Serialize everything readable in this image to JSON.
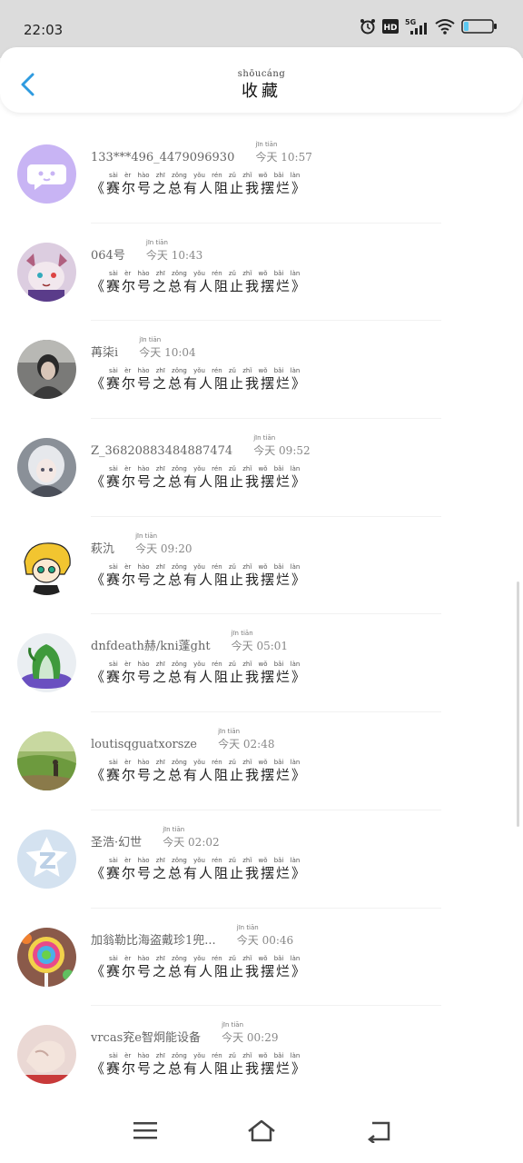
{
  "status_bar": {
    "time": "22:03",
    "icons": [
      "alarm-icon",
      "hd-icon",
      "5g-signal-icon",
      "wifi-icon",
      "battery-icon"
    ],
    "hd_label": "HD",
    "network_label": "5G"
  },
  "header": {
    "title_pinyin": "shōucáng",
    "title": "收藏"
  },
  "items": [
    {
      "name": "133***496_4479096930",
      "time": "今天 10:57",
      "time_pinyin": "jīn tiān",
      "message": "《赛尔号之总有人阻止我摆烂》",
      "avatar": "chat-bubble-avatar"
    },
    {
      "name": "064号",
      "time": "今天 10:43",
      "time_pinyin": "jīn tiān",
      "message": "《赛尔号之总有人阻止我摆烂》",
      "avatar": "wolf-character-avatar"
    },
    {
      "name": "苒柒i",
      "time": "今天 10:04",
      "time_pinyin": "jīn tiān",
      "message": "《赛尔号之总有人阻止我摆烂》",
      "avatar": "photo-person-avatar"
    },
    {
      "name": "Z_36820883484887474",
      "time": "今天 09:52",
      "time_pinyin": "jīn tiān",
      "message": "《赛尔号之总有人阻止我摆烂》",
      "avatar": "anime-girl-avatar"
    },
    {
      "name": "萩氿",
      "time": "今天 09:20",
      "time_pinyin": "jīn tiān",
      "message": "《赛尔号之总有人阻止我摆烂》",
      "avatar": "cartoon-character-avatar"
    },
    {
      "name": "dnfdeath赫/kni蓬ght",
      "time": "今天 05:01",
      "time_pinyin": "jīn tiān",
      "message": "《赛尔号之总有人阻止我摆烂》",
      "avatar": "jade-cabbage-avatar"
    },
    {
      "name": "loutisqguatxorsze",
      "time": "今天 02:48",
      "time_pinyin": "jīn tiān",
      "message": "《赛尔号之总有人阻止我摆烂》",
      "avatar": "landscape-avatar"
    },
    {
      "name": "圣浩·幻世",
      "time": "今天 02:02",
      "time_pinyin": "jīn tiān",
      "message": "《赛尔号之总有人阻止我摆烂》",
      "avatar": "default-z-avatar"
    },
    {
      "name": "加翁勒比海盗戴珍1兜...",
      "time": "今天 00:46",
      "time_pinyin": "jīn tiān",
      "message": "《赛尔号之总有人阻止我摆烂》",
      "avatar": "lollipop-avatar"
    },
    {
      "name": "vrcas兖e智炯能设备",
      "time": "今天 00:29",
      "time_pinyin": "jīn tiān",
      "message": "《赛尔号之总有人阻止我摆烂》",
      "avatar": "hand-photo-avatar"
    }
  ],
  "message_pinyin": "sài èr hào zhī zǒng yǒu rén zǔ zhǐ wǒ bǎi làn",
  "navbar": {
    "icons": [
      "menu-icon",
      "home-icon",
      "back-nav-icon"
    ]
  },
  "colors": {
    "accent": "#2f9be0",
    "status_bar_bg": "#dcdcdc"
  }
}
